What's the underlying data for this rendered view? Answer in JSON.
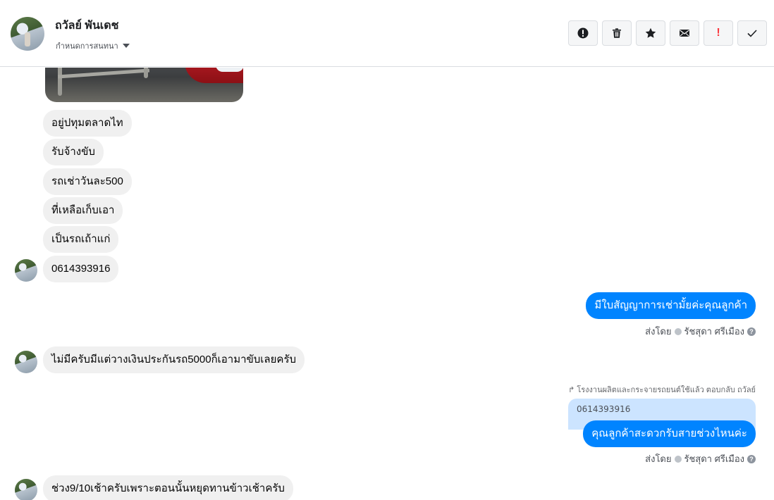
{
  "header": {
    "contact_name": "ถวัลย์ พันเดช",
    "assign_label": "กำหนดการสนทนา",
    "actions": [
      {
        "name": "mark-follow-up-button",
        "icon": "exclamation-circle-icon"
      },
      {
        "name": "delete-button",
        "icon": "trash-icon"
      },
      {
        "name": "star-button",
        "icon": "star-icon"
      },
      {
        "name": "mark-unread-button",
        "icon": "envelope-icon"
      },
      {
        "name": "mark-spam-button",
        "icon": "spam-exclamation-icon",
        "glyph": "!"
      },
      {
        "name": "mark-done-button",
        "icon": "checkmark-icon"
      }
    ]
  },
  "messages": {
    "in_1": "อยู่ปทุมตลาดไท",
    "in_2": "รับจ้างขับ",
    "in_3": "รถเช่าวันละ500",
    "in_4": "ที่เหลือเก็บเอา",
    "in_5": "เป็นรถเถ้าแก่",
    "in_6": "0614393916",
    "out_1": "มีใบสัญญาการเช่ามั้ยค่ะคุณลูกค้า",
    "in_7": "ไม่มีครับมีแต่วางเงินประกันรถ5000ก็เอามาขับเลยครับ",
    "reply_note": "โรงงานผลิตและกระจายรถยนต์ใช้แล้ว ตอบกลับ ถวัลย์",
    "quoted": "0614393916",
    "out_2": "คุณลูกค้าสะดวกรับสายช่วงไหนค่ะ",
    "in_8": "ช่วง9/10เช้าครับเพราะตอนนั้นหยุดทานข้าวเช้าครับ"
  },
  "sent_by": {
    "label": "ส่งโดย",
    "agent": "รัชสุดา ศรีเมือง",
    "help": "?"
  },
  "colors": {
    "outgoing": "#0084ff",
    "incoming": "#f0f0f0",
    "quote_bg": "#cce4ff"
  }
}
